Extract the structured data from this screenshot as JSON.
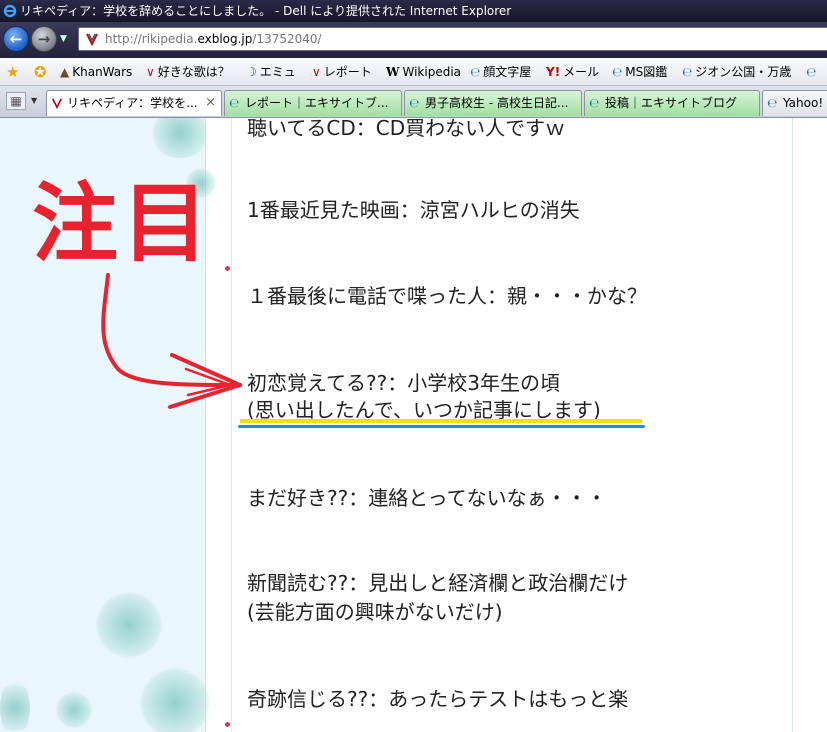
{
  "window": {
    "title": "リキペディア：学校を辞めることにしました。 - Dell により提供された Internet Explorer"
  },
  "address_bar": {
    "url_prefix": "http://rikipedia.",
    "url_domain": "exblog.jp",
    "url_suffix": "/13752040/"
  },
  "favorites": [
    {
      "label": "KhanWars"
    },
    {
      "label": "好きな歌は？"
    },
    {
      "label": "エミュ"
    },
    {
      "label": "レポート"
    },
    {
      "label": "Wikipedia"
    },
    {
      "label": "顔文字屋"
    },
    {
      "label": "メール"
    },
    {
      "label": "MS図鑑"
    },
    {
      "label": "ジオン公国・万歳"
    }
  ],
  "tabs": [
    {
      "label": "リキペディア：学校を..."
    },
    {
      "label": "レポート｜エキサイトブ..."
    },
    {
      "label": "男子高校生 - 高校生日記..."
    },
    {
      "label": "投稿｜エキサイトブログ"
    },
    {
      "label": "Yahoo!"
    }
  ],
  "annotation": {
    "text": "注目"
  },
  "content": {
    "lines": [
      "聴いてるCD：CD買わない人ですｗ",
      "1番最近見た映画：涼宮ハルヒの消失",
      "１番最後に電話で喋った人：親・・・かな？",
      "初恋覚えてる??：小学校3年生の頃",
      "(思い出したんで、いつか記事にします)",
      "まだ好き??：連絡とってないなぁ・・・",
      "新聞読む??：見出しと経済欄と政治欄だけ",
      "(芸能方面の興味がないだけ)",
      "奇跡信じる??：あったらテストはもっと楽"
    ]
  },
  "colors": {
    "annotation": "#e8232f",
    "highlight_yellow": "#f2e200",
    "highlight_blue": "#1b8fd8"
  }
}
